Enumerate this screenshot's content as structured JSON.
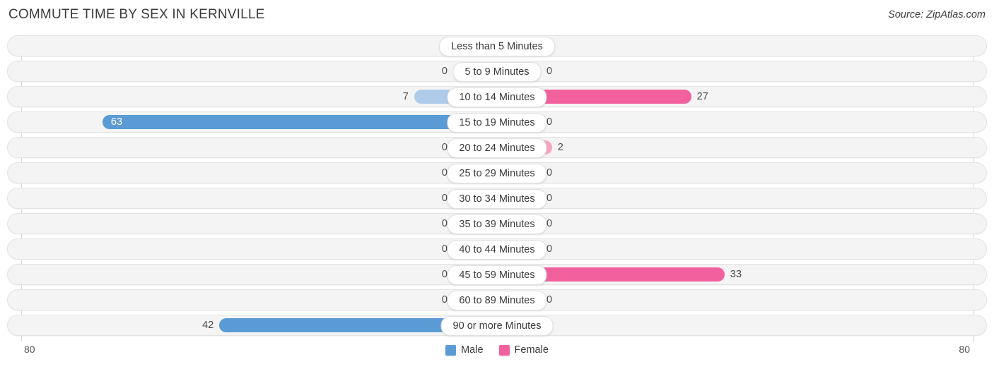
{
  "header": {
    "title": "COMMUTE TIME BY SEX IN KERNVILLE",
    "source": "Source: ZipAtlas.com"
  },
  "axis": {
    "left_label": "80",
    "right_label": "80"
  },
  "legend": {
    "items": [
      {
        "label": "Male",
        "color": "#5b9bd5",
        "icon": "legend-swatch-male"
      },
      {
        "label": "Female",
        "color": "#f2609e",
        "icon": "legend-swatch-female"
      }
    ]
  },
  "chart_data": {
    "type": "bar",
    "orientation": "horizontal-diverging",
    "title": "COMMUTE TIME BY SEX IN KERNVILLE",
    "xlabel": "",
    "ylabel": "",
    "xlim": [
      80,
      80
    ],
    "axis_max": 80,
    "grid": true,
    "legend_position": "bottom-center",
    "categories": [
      "Less than 5 Minutes",
      "5 to 9 Minutes",
      "10 to 14 Minutes",
      "15 to 19 Minutes",
      "20 to 24 Minutes",
      "25 to 29 Minutes",
      "30 to 34 Minutes",
      "35 to 39 Minutes",
      "40 to 44 Minutes",
      "45 to 59 Minutes",
      "60 to 89 Minutes",
      "90 or more Minutes"
    ],
    "series": [
      {
        "name": "Male",
        "color": "#5b9bd5",
        "values": [
          0,
          0,
          7,
          63,
          0,
          0,
          0,
          0,
          0,
          0,
          0,
          42
        ]
      },
      {
        "name": "Female",
        "color": "#f2609e",
        "values": [
          0,
          0,
          27,
          0,
          2,
          0,
          0,
          0,
          0,
          33,
          0,
          0
        ]
      }
    ]
  },
  "rows": [
    {
      "label": "Less than 5 Minutes",
      "male": "0",
      "female": "0"
    },
    {
      "label": "5 to 9 Minutes",
      "male": "0",
      "female": "0"
    },
    {
      "label": "10 to 14 Minutes",
      "male": "7",
      "female": "27"
    },
    {
      "label": "15 to 19 Minutes",
      "male": "63",
      "female": "0"
    },
    {
      "label": "20 to 24 Minutes",
      "male": "0",
      "female": "2"
    },
    {
      "label": "25 to 29 Minutes",
      "male": "0",
      "female": "0"
    },
    {
      "label": "30 to 34 Minutes",
      "male": "0",
      "female": "0"
    },
    {
      "label": "35 to 39 Minutes",
      "male": "0",
      "female": "0"
    },
    {
      "label": "40 to 44 Minutes",
      "male": "0",
      "female": "0"
    },
    {
      "label": "45 to 59 Minutes",
      "male": "0",
      "female": "33"
    },
    {
      "label": "60 to 89 Minutes",
      "male": "0",
      "female": "0"
    },
    {
      "label": "90 or more Minutes",
      "male": "42",
      "female": "0"
    }
  ]
}
